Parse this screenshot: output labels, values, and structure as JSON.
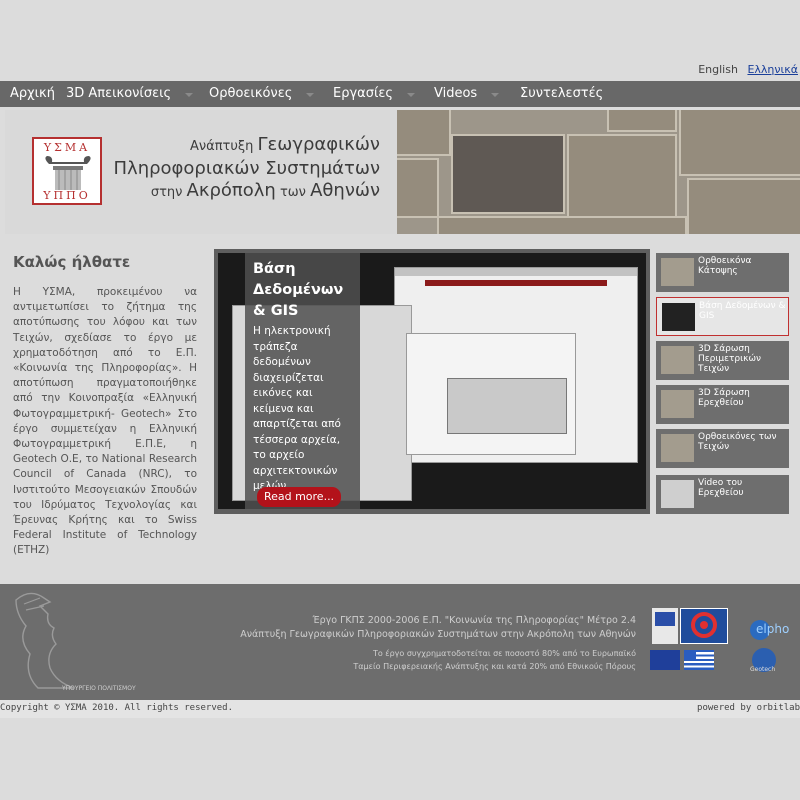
{
  "lang": {
    "en": "English",
    "el": "Ελληνικά"
  },
  "nav": {
    "home": "Αρχική",
    "viz3d": "3D Απεικονίσεις",
    "ortho": "Ορθοεικόνες",
    "works": "Εργασίες",
    "videos": "Videos",
    "credits": "Συντελεστές"
  },
  "header": {
    "logo_top": "ΥΣΜΑ",
    "logo_bottom": "ΥΠΠΟ",
    "line1_prefix": "Ανάπτυξη ",
    "line1_bold": "Γεωγραφικών",
    "line2": "Πληροφοριακών Συστημάτων",
    "line3_prefix": "στην ",
    "line3_bold": "Ακρόπολη",
    "line3_mid": " των ",
    "line3_end": "Αθηνών"
  },
  "welcome": {
    "title": "Καλώς ήλθατε",
    "body": "Η ΥΣΜΑ, προκειμένου να αντιμετωπίσει το ζήτημα της αποτύπωσης του λόφου και των Τειχών, σχεδίασε το έργο με χρηματοδότηση από το Ε.Π. «Κοινωνία της Πληροφορίας». Η αποτύπωση πραγματοποιήθηκε από την Κοινοπραξία «Ελληνική Φωτογραμμετρική- Geotech» Στο έργο συμμετείχαν η Ελληνική Φωτογραμμετρική Ε.Π.Ε, η Geotech Ο.Ε, το National Research Council of Canada (NRC), το Ινστιτούτο Μεσογειακών Σπουδών του Ιδρύματος Τεχνολογίας και Έρευνας Κρήτης και το Swiss Federal Institute of Technology (ETHZ)"
  },
  "slide": {
    "title": "Βάση Δεδομένων & GIS",
    "text": "Η ηλεκτρονική τράπεζα δεδομένων διαχειρίζεται εικόνες και κείμενα και απαρτίζεται από τέσσερα αρχεία, το αρχείο αρχιτεκτονικών μελών....",
    "read_more": "Read more..."
  },
  "thumbs": [
    "Ορθοεικόνα Κάτοψης",
    "Βάση Δεδομένων & GIS",
    "3D Σάρωση Περιμετρικών Τειχών",
    "3D Σάρωση Ερεχθείου",
    "Ορθοεικόνες των Τειχών",
    "Video του Ερεχθείου"
  ],
  "footer": {
    "line1": "Έργο ΓΚΠΣ 2000-2006 Ε.Π. \"Κοινωνία της Πληροφορίας\" Μέτρο 2.4",
    "line2": "Ανάπτυξη Γεωγραφικών Πληροφοριακών Συστημάτων στην Ακρόπολη των Αθηνών",
    "line3": "Το έργο συγχρηματοδοτείται σε ποσοστό 80% από το Ευρωπαϊκό",
    "line4": "Ταμείο Περιφερειακής Ανάπτυξης και κατά 20% από Εθνικούς Πόρους",
    "ministry": "ΥΠΟΥΡΓΕΙΟ ΠΟΛΙΤΙΣΜΟΥ",
    "elpho": "elpho",
    "geotech": "Geotech"
  },
  "bottom": {
    "copyright": "Copyright © ΥΣΜΑ 2010. All rights reserved.",
    "powered": "powered by orbitlab"
  },
  "colors": {
    "nav_bg": "#686868",
    "accent_red": "#b3121a",
    "footer_bg": "#6d6d6d"
  }
}
